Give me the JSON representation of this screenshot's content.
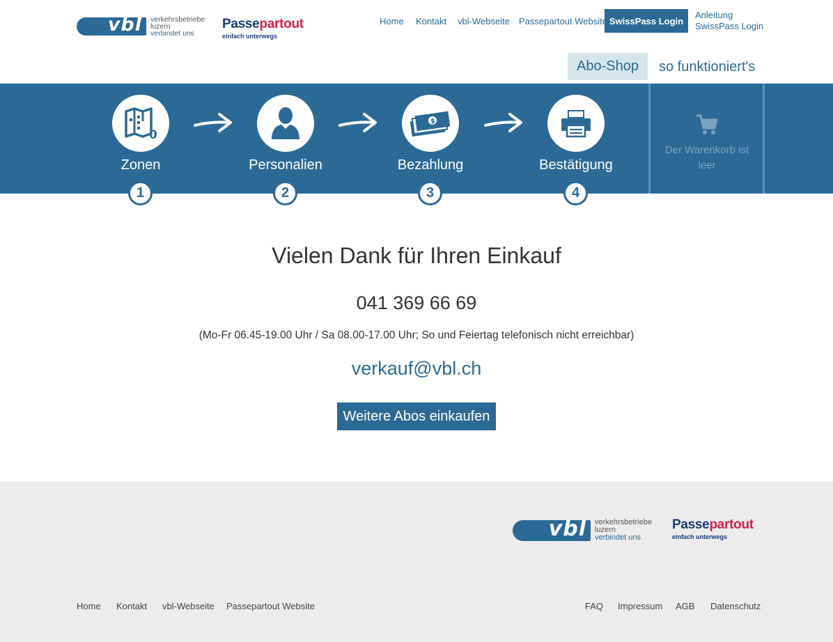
{
  "header": {
    "vbl_logo": {
      "mark": "vbl",
      "line1": "verkehrsbetriebe",
      "line2": "luzern",
      "tagline": "verbindet uns"
    },
    "pp_logo": {
      "name_part1": "Passe",
      "name_part2": "partout",
      "slogan": "einfach unterwegs"
    },
    "nav": {
      "home": "Home",
      "kontakt": "Kontakt",
      "vbl": "vbl-Webseite",
      "passepartout": "Passepartout Website",
      "login": "SwissPass Login",
      "anleitung_line1": "Anleitung",
      "anleitung_line2": "SwissPass Login"
    },
    "subnav": {
      "shop": "Abo-Shop",
      "how": "so funktioniert's"
    }
  },
  "steps": [
    {
      "label": "Zonen",
      "number": "1",
      "icon": "map-zones-icon"
    },
    {
      "label": "Personalien",
      "number": "2",
      "icon": "person-icon"
    },
    {
      "label": "Bezahlung",
      "number": "3",
      "icon": "money-icon"
    },
    {
      "label": "Bestätigung",
      "number": "4",
      "icon": "printer-icon"
    }
  ],
  "cart": {
    "line1": "Der Warenkorb ist",
    "line2": "leer",
    "icon": "cart-icon"
  },
  "main": {
    "title": "Vielen Dank für Ihren Einkauf",
    "phone": "041 369 66 69",
    "hours": "(Mo-Fr 06.45-19.00 Uhr / Sa 08.00-17.00 Uhr; So und Feiertag telefonisch nicht erreichbar)",
    "email": "verkauf@vbl.ch",
    "button": "Weitere Abos einkaufen"
  },
  "footer": {
    "links_left": [
      "Home",
      "Kontakt",
      "vbl-Webseite",
      "Passepartout Website"
    ],
    "links_right": [
      "FAQ",
      "Impressum",
      "AGB",
      "Datenschutz"
    ]
  },
  "colors": {
    "brand_blue": "#2b6a96",
    "pp_blue": "#1a3a7a",
    "pp_red": "#d4204b",
    "footer_bg": "#ececec"
  }
}
